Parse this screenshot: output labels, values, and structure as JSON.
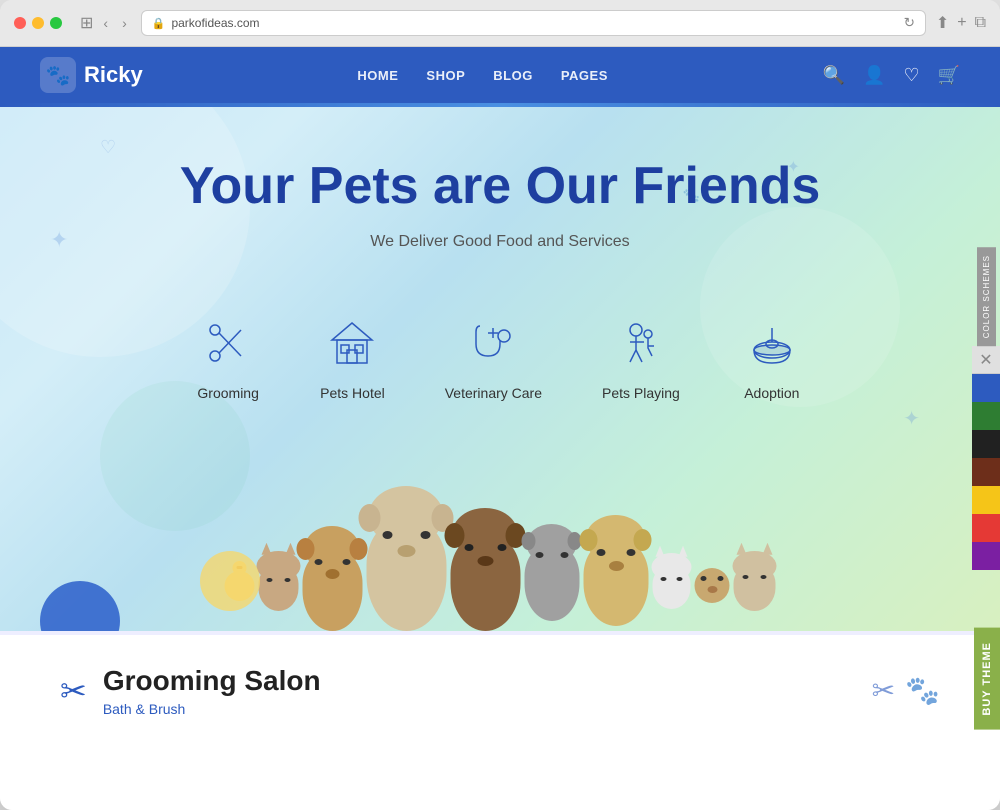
{
  "browser": {
    "url": "parkofideas.com",
    "dots": [
      "red",
      "yellow",
      "green"
    ]
  },
  "nav": {
    "logo_text": "Ricky",
    "menu_items": [
      {
        "label": "HOME"
      },
      {
        "label": "SHOP"
      },
      {
        "label": "BLOG"
      },
      {
        "label": "PAGES"
      }
    ]
  },
  "hero": {
    "title": "Your Pets are Our Friends",
    "subtitle": "We Deliver Good Food and Services"
  },
  "services": [
    {
      "label": "Grooming",
      "icon": "scissors"
    },
    {
      "label": "Pets Hotel",
      "icon": "house"
    },
    {
      "label": "Veterinary Care",
      "icon": "stethoscope"
    },
    {
      "label": "Pets Playing",
      "icon": "play"
    },
    {
      "label": "Adoption",
      "icon": "bowl"
    }
  ],
  "grooming": {
    "title": "Grooming Salon",
    "subtitle": "Bath & Brush"
  },
  "color_schemes": {
    "label": "COLOR SCHEMES",
    "colors": [
      "#2d5bbf",
      "#2e7d32",
      "#212121",
      "#6d2e1a",
      "#f5c518",
      "#e53935",
      "#7b1fa2"
    ]
  },
  "buy_theme": {
    "label": "Buy Theme"
  }
}
